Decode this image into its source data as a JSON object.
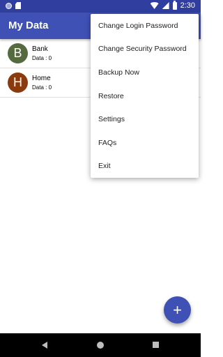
{
  "status_bar": {
    "time": "2:30"
  },
  "app_bar": {
    "title": "My Data"
  },
  "list": {
    "items": [
      {
        "letter": "B",
        "name": "Bank",
        "data": "Data : 0",
        "color": "#556b3f"
      },
      {
        "letter": "H",
        "name": "Home",
        "data": "Data : 0",
        "color": "#8b3a0e"
      }
    ]
  },
  "menu": {
    "items": [
      "Change Login Password",
      "Change Security Password",
      "Backup Now",
      "Restore",
      "Settings",
      "FAQs",
      "Exit"
    ]
  },
  "fab": {
    "label": "+"
  },
  "colors": {
    "primary": "#3f51b5",
    "primary_dark": "#303f9f"
  }
}
